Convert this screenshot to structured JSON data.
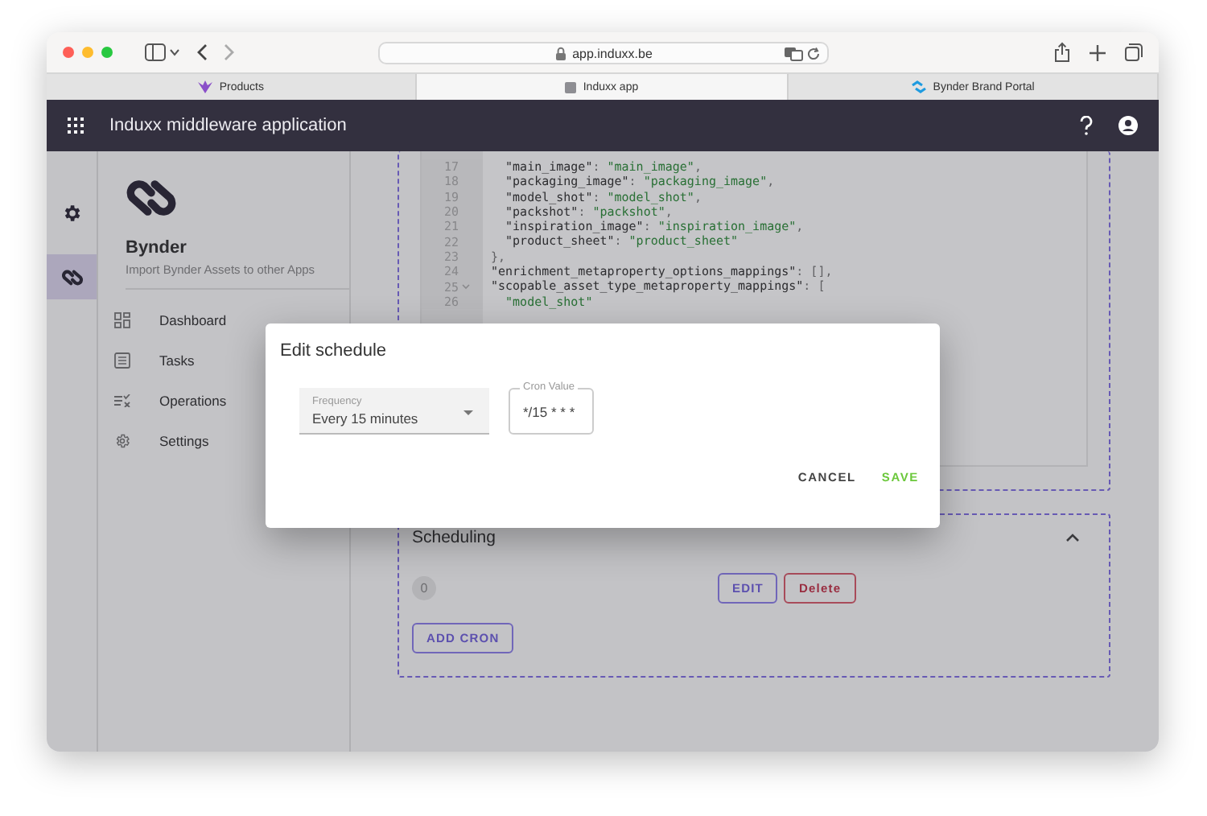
{
  "browser": {
    "url": "app.induxx.be",
    "tabs": [
      {
        "label": "Products",
        "kind": "products",
        "selected": false
      },
      {
        "label": "Induxx app",
        "kind": "induxx",
        "selected": true
      },
      {
        "label": "Bynder Brand Portal",
        "kind": "bynder",
        "selected": false
      }
    ]
  },
  "app_bar": {
    "title": "Induxx middleware application"
  },
  "rail": {
    "items": [
      {
        "kind": "settings",
        "selected": false
      },
      {
        "kind": "bynder",
        "selected": true
      }
    ]
  },
  "sidebar": {
    "title": "Bynder",
    "subtitle": "Import Bynder Assets to other Apps",
    "items": [
      {
        "label": "Dashboard",
        "kind": "dashboard"
      },
      {
        "label": "Tasks",
        "kind": "tasks"
      },
      {
        "label": "Operations",
        "kind": "operations"
      },
      {
        "label": "Settings",
        "kind": "settings"
      }
    ]
  },
  "code": {
    "lines": [
      {
        "number": "17",
        "foldable": false,
        "tokens": [
          {
            "kind": "key",
            "text": "  \"main_image\""
          },
          {
            "kind": "punct",
            "text": ": "
          },
          {
            "kind": "string",
            "text": "\"main_image\""
          },
          {
            "kind": "punct",
            "text": ","
          }
        ]
      },
      {
        "number": "18",
        "foldable": false,
        "tokens": [
          {
            "kind": "key",
            "text": "  \"packaging_image\""
          },
          {
            "kind": "punct",
            "text": ": "
          },
          {
            "kind": "string",
            "text": "\"packaging_image\""
          },
          {
            "kind": "punct",
            "text": ","
          }
        ]
      },
      {
        "number": "19",
        "foldable": false,
        "tokens": [
          {
            "kind": "key",
            "text": "  \"model_shot\""
          },
          {
            "kind": "punct",
            "text": ": "
          },
          {
            "kind": "string",
            "text": "\"model_shot\""
          },
          {
            "kind": "punct",
            "text": ","
          }
        ]
      },
      {
        "number": "20",
        "foldable": false,
        "tokens": [
          {
            "kind": "key",
            "text": "  \"packshot\""
          },
          {
            "kind": "punct",
            "text": ": "
          },
          {
            "kind": "string",
            "text": "\"packshot\""
          },
          {
            "kind": "punct",
            "text": ","
          }
        ]
      },
      {
        "number": "21",
        "foldable": false,
        "tokens": [
          {
            "kind": "key",
            "text": "  \"inspiration_image\""
          },
          {
            "kind": "punct",
            "text": ": "
          },
          {
            "kind": "string",
            "text": "\"inspiration_image\""
          },
          {
            "kind": "punct",
            "text": ","
          }
        ]
      },
      {
        "number": "22",
        "foldable": false,
        "tokens": [
          {
            "kind": "key",
            "text": "  \"product_sheet\""
          },
          {
            "kind": "punct",
            "text": ": "
          },
          {
            "kind": "string",
            "text": "\"product_sheet\""
          }
        ]
      },
      {
        "number": "23",
        "foldable": false,
        "tokens": [
          {
            "kind": "punct",
            "text": "},"
          }
        ]
      },
      {
        "number": "24",
        "foldable": false,
        "tokens": [
          {
            "kind": "key",
            "text": "\"enrichment_metaproperty_options_mappings\""
          },
          {
            "kind": "punct",
            "text": ": [],"
          }
        ]
      },
      {
        "number": "25",
        "foldable": true,
        "tokens": [
          {
            "kind": "key",
            "text": "\"scopable_asset_type_metaproperty_mappings\""
          },
          {
            "kind": "punct",
            "text": ": ["
          }
        ]
      },
      {
        "number": "26",
        "foldable": false,
        "tokens": [
          {
            "kind": "string",
            "text": "  \"model_shot\""
          }
        ]
      }
    ]
  },
  "scheduling": {
    "title": "Scheduling",
    "expanded": true,
    "count": "0",
    "edit_button": "EDIT",
    "delete_button": "Delete",
    "add_button": "ADD CRON"
  },
  "dialog": {
    "title": "Edit schedule",
    "frequency": {
      "label": "Frequency",
      "value": "Every 15 minutes"
    },
    "cron": {
      "label": "Cron Value",
      "value": "*/15 * * *"
    },
    "cancel": "CANCEL",
    "save": "SAVE"
  }
}
